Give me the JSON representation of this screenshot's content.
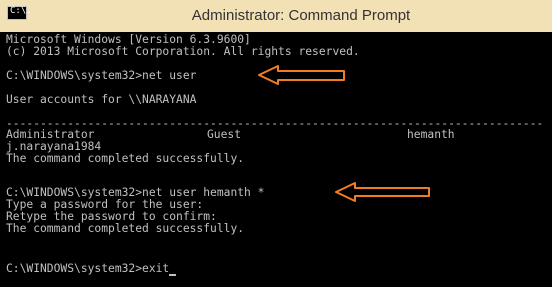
{
  "window": {
    "title": "Administrator: Command Prompt",
    "icon_text": "C:\\.",
    "icon_name": "cmd-icon"
  },
  "console": {
    "lines": [
      "Microsoft Windows [Version 6.3.9600]",
      "(c) 2013 Microsoft Corporation. All rights reserved.",
      "",
      "C:\\WINDOWS\\system32>net user",
      "",
      "User accounts for \\\\NARAYANA",
      "",
      "-------------------------------------------------------------------------------",
      "",
      "j.narayana1984",
      "The command completed successfully.",
      "",
      "",
      "C:\\WINDOWS\\system32>net user hemanth *",
      "Type a password for the user:",
      "Retype the password to confirm:",
      "The command completed successfully.",
      "",
      "",
      "C:\\WINDOWS\\system32>exit"
    ],
    "accounts_row": [
      "Administrator",
      "Guest",
      "hemanth"
    ]
  },
  "annotations": {
    "arrow_color": "#f07d24",
    "arrow_1_target": "net user",
    "arrow_2_target": "net user hemanth *"
  }
}
